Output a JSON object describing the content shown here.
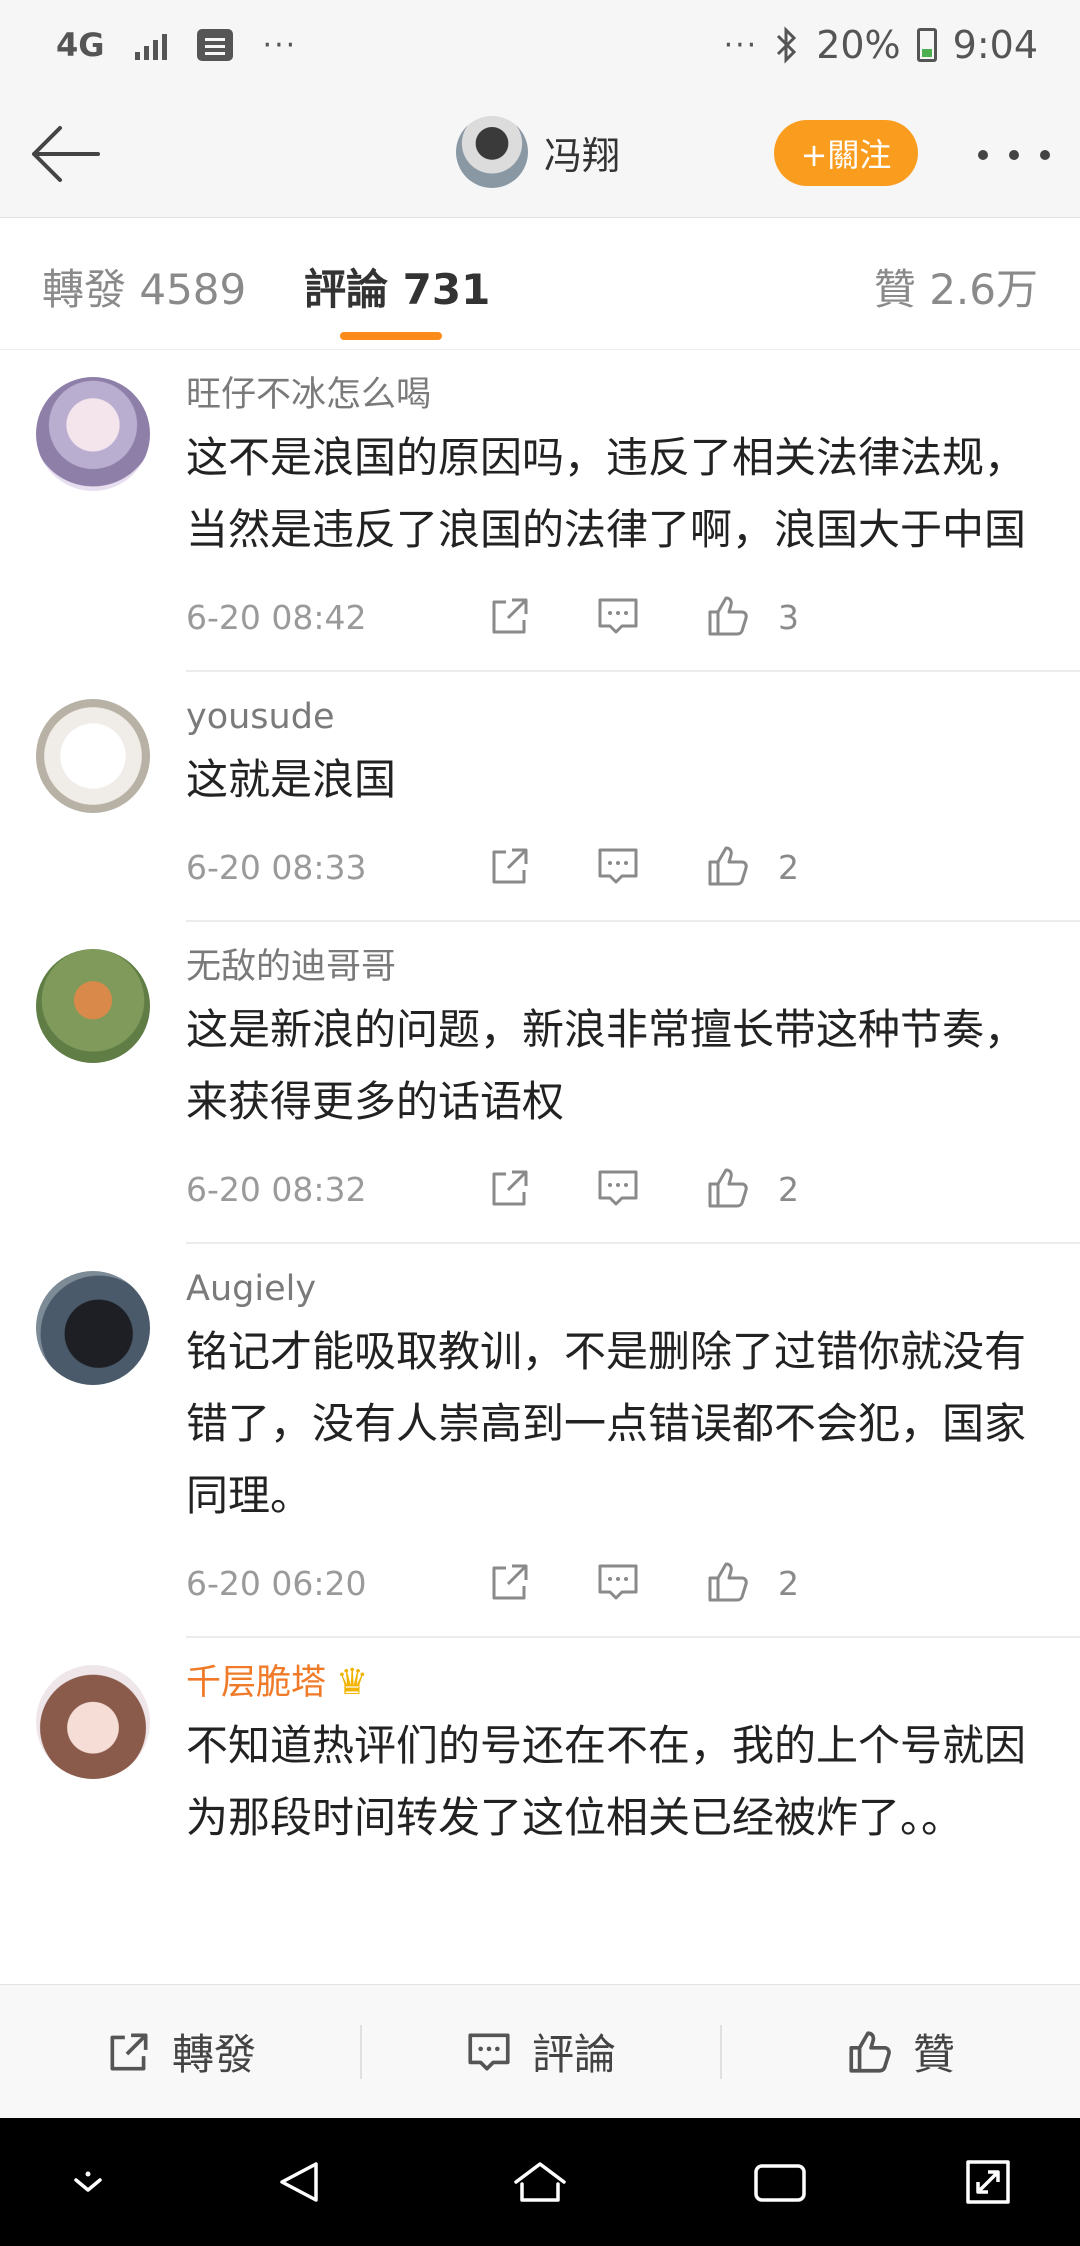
{
  "status_bar": {
    "network": "4G",
    "left_dots": "···",
    "right_dots": "···",
    "battery": "20%",
    "time": "9:04"
  },
  "nav": {
    "user_name": "冯翔",
    "follow_label": "+關注"
  },
  "tabs": {
    "repost": "轉發 4589",
    "comments": "評論 731",
    "likes": "贊 2.6万"
  },
  "comments": [
    {
      "user": "旺仔不冰怎么喝",
      "text": "这不是浪国的原因吗，违反了相关法律法规，当然是违反了浪国的法律了啊，浪国大于中国",
      "time": "6-20 08:42",
      "likes": "3"
    },
    {
      "user": "yousude",
      "text": "这就是浪国",
      "time": "6-20 08:33",
      "likes": "2"
    },
    {
      "user": "无敌的迪哥哥",
      "text": "这是新浪的问题，新浪非常擅长带这种节奏，来获得更多的话语权",
      "time": "6-20 08:32",
      "likes": "2"
    },
    {
      "user": "Augiely",
      "text": "铭记才能吸取教训，不是删除了过错你就没有错了，没有人崇高到一点错误都不会犯，国家同理。",
      "time": "6-20 06:20",
      "likes": "2"
    },
    {
      "user": "千层脆塔",
      "text": "不知道热评们的号还在不在，我的上个号就因为那段时间转发了这位相关已经被炸了。。",
      "vip_icon": "crown-icon"
    }
  ],
  "bottom_bar": {
    "repost": "轉發",
    "comment": "評論",
    "like": "贊"
  },
  "colors": {
    "accent": "#fa9d1e",
    "vip_name": "#f07a28"
  }
}
